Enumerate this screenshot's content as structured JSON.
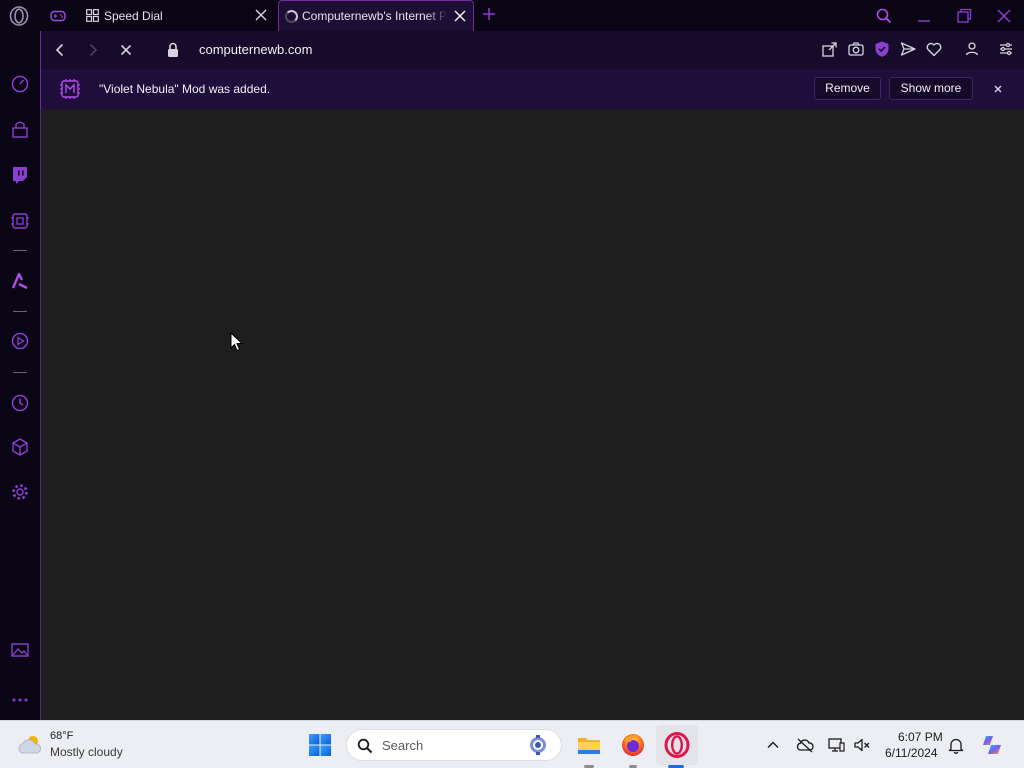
{
  "browser": {
    "tabs": [
      {
        "label": "Speed Dial",
        "active": false
      },
      {
        "label": "Computernewb's Internet Portal",
        "active": true,
        "loading": true
      }
    ],
    "address": {
      "url": "computernewb.com",
      "secure": true
    },
    "accent_color": "#8a3fd1",
    "notification": {
      "message": "\"Violet Nebula\" Mod was added.",
      "remove_label": "Remove",
      "show_more_label": "Show more"
    },
    "sidebar_items": [
      "speedometer-icon",
      "pinboard-icon",
      "twitch-icon",
      "gx-mods-icon",
      "aria-icon",
      "player-icon",
      "history-icon",
      "extensions-cube-icon",
      "settings-icon",
      "gallery-icon",
      "more-icon"
    ],
    "content_background": "#1e1e1e"
  },
  "taskbar": {
    "weather": {
      "temperature": "68°F",
      "condition": "Mostly cloudy"
    },
    "search_placeholder": "Search",
    "clock": {
      "time": "6:07 PM",
      "date": "6/11/2024"
    },
    "apps": [
      "file-explorer-icon",
      "firefox-icon",
      "opera-gx-icon"
    ]
  }
}
